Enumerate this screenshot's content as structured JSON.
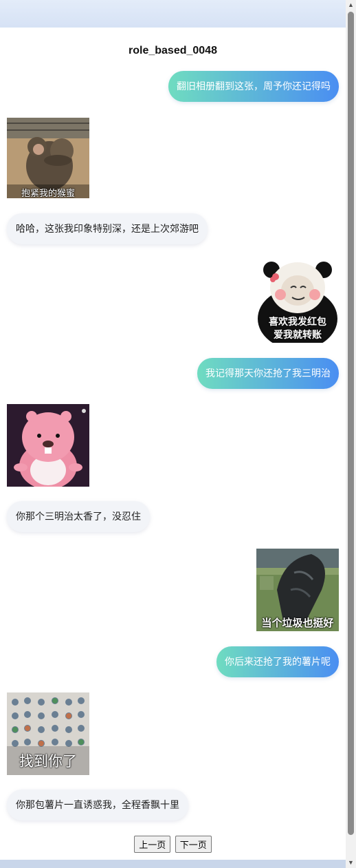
{
  "title": "role_based_0048",
  "messages": [
    {
      "type": "text",
      "side": "out",
      "text": "翻旧相册翻到这张，周予你还记得吗"
    },
    {
      "type": "sticker",
      "side": "in",
      "caption": "抱紧我的猴蜜",
      "icon": "monkey-hug-sticker"
    },
    {
      "type": "text",
      "side": "in",
      "text": "哈哈，这张我印象特别深，还是上次郊游吧"
    },
    {
      "type": "sticker",
      "side": "out",
      "caption_lines": [
        "喜欢我发红包",
        "爱我就转账"
      ],
      "icon": "panda-meme-sticker"
    },
    {
      "type": "text",
      "side": "out",
      "text": "我记得那天你还抢了我三明治"
    },
    {
      "type": "sticker",
      "side": "in",
      "caption": "",
      "icon": "pink-beaver-sticker"
    },
    {
      "type": "text",
      "side": "in",
      "text": "你那个三明治太香了，没忍住"
    },
    {
      "type": "sticker",
      "side": "out",
      "caption": "当个垃圾也挺好",
      "icon": "trash-bag-sticker"
    },
    {
      "type": "text",
      "side": "out",
      "text": "你后来还抢了我的薯片呢"
    },
    {
      "type": "sticker",
      "side": "in",
      "caption": "找到你了",
      "icon": "emoji-sheet-sticker"
    },
    {
      "type": "text",
      "side": "in",
      "text": "你那包薯片一直诱惑我，全程香飘十里"
    }
  ],
  "pager": {
    "prev_label": "上一页",
    "next_label": "下一页"
  },
  "colors": {
    "out_bubble_start": "#6fdcc0",
    "out_bubble_end": "#4a8ef2",
    "in_bubble": "#f2f4f8"
  }
}
